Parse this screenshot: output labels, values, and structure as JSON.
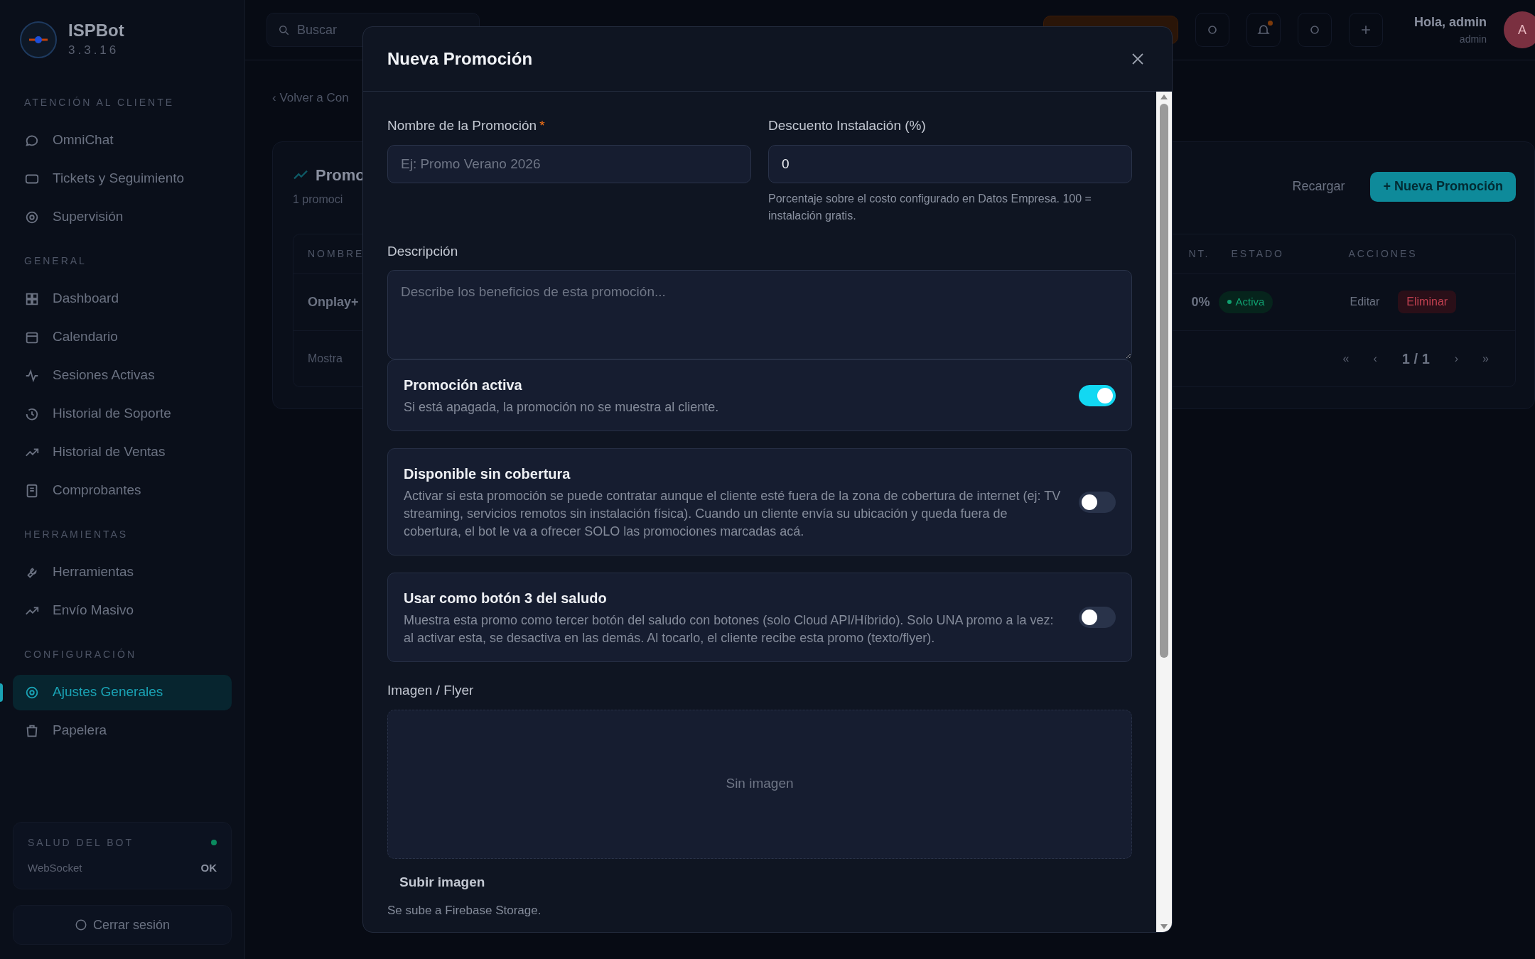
{
  "sidebar": {
    "brand": "ISPBot",
    "version": "3.3.16",
    "sections": [
      {
        "title": "ATENCIÓN AL CLIENTE",
        "items": [
          {
            "label": "OmniChat",
            "selected": false
          },
          {
            "label": "Tickets y Seguimiento",
            "selected": false
          },
          {
            "label": "Supervisión",
            "selected": false
          }
        ]
      },
      {
        "title": "GENERAL",
        "items": [
          {
            "label": "Dashboard",
            "selected": false
          },
          {
            "label": "Calendario",
            "selected": false
          },
          {
            "label": "Sesiones Activas",
            "selected": false
          },
          {
            "label": "Historial de Soporte",
            "selected": false
          },
          {
            "label": "Historial de Ventas",
            "selected": false
          },
          {
            "label": "Comprobantes",
            "selected": false
          }
        ]
      },
      {
        "title": "HERRAMIENTAS",
        "items": [
          {
            "label": "Herramientas",
            "selected": false
          },
          {
            "label": "Envío Masivo",
            "selected": false
          }
        ]
      },
      {
        "title": "CONFIGURACIÓN",
        "items": [
          {
            "label": "Ajustes Generales",
            "selected": true
          },
          {
            "label": "Papelera",
            "selected": false
          }
        ]
      }
    ],
    "health": {
      "title": "SALUD DEL BOT",
      "rows": [
        {
          "label": "WebSocket",
          "value": "OK"
        }
      ]
    },
    "logout": "Cerrar sesión"
  },
  "topbar": {
    "search_placeholder": "Buscar",
    "greeting": "Hola, admin",
    "role": "admin",
    "avatar": "A"
  },
  "page": {
    "back": "‹ Volver a Con",
    "title": "Promo",
    "subtitle": "1 promoci",
    "reload": "Recargar",
    "new_button": "+ Nueva Promoción",
    "table": {
      "left_header": "NOMBRE",
      "right_headers": [
        "NT.",
        "ESTADO",
        "ACCIONES"
      ],
      "row": {
        "name": "Onplay+",
        "discount": "0%",
        "status": "Activa",
        "edit": "Editar",
        "delete": "Eliminar"
      }
    },
    "footer": "Mostra",
    "pager": [
      "«",
      "‹",
      "1 / 1",
      "›",
      "»"
    ]
  },
  "modal": {
    "title": "Nueva Promoción",
    "name_field": {
      "label": "Nombre de la Promoción",
      "required_mark": "*",
      "placeholder": "Ej: Promo Verano 2026"
    },
    "discount_field": {
      "label": "Descuento Instalación (%)",
      "value": "0",
      "help": "Porcentaje sobre el costo configurado en Datos Empresa. 100 = instalación gratis."
    },
    "description_field": {
      "label": "Descripción",
      "placeholder": "Describe los beneficios de esta promoción..."
    },
    "toggles": [
      {
        "title": "Promoción activa",
        "description": "Si está apagada, la promoción no se muestra al cliente.",
        "on": true
      },
      {
        "title": "Disponible sin cobertura",
        "description": "Activar si esta promoción se puede contratar aunque el cliente esté fuera de la zona de cobertura de internet (ej: TV streaming, servicios remotos sin instalación física). Cuando un cliente envía su ubicación y queda fuera de cobertura, el bot le va a ofrecer SOLO las promociones marcadas acá.",
        "on": false
      },
      {
        "title": "Usar como botón 3 del saludo",
        "description": "Muestra esta promo como tercer botón del saludo con botones (solo Cloud API/Híbrido). Solo UNA promo a la vez: al activar esta, se desactiva en las demás. Al tocarlo, el cliente recibe esta promo (texto/flyer).",
        "on": false
      }
    ],
    "image": {
      "label": "Imagen / Flyer",
      "empty_text": "Sin imagen",
      "upload_button": "Subir imagen",
      "help": "Se sube a Firebase Storage."
    }
  }
}
